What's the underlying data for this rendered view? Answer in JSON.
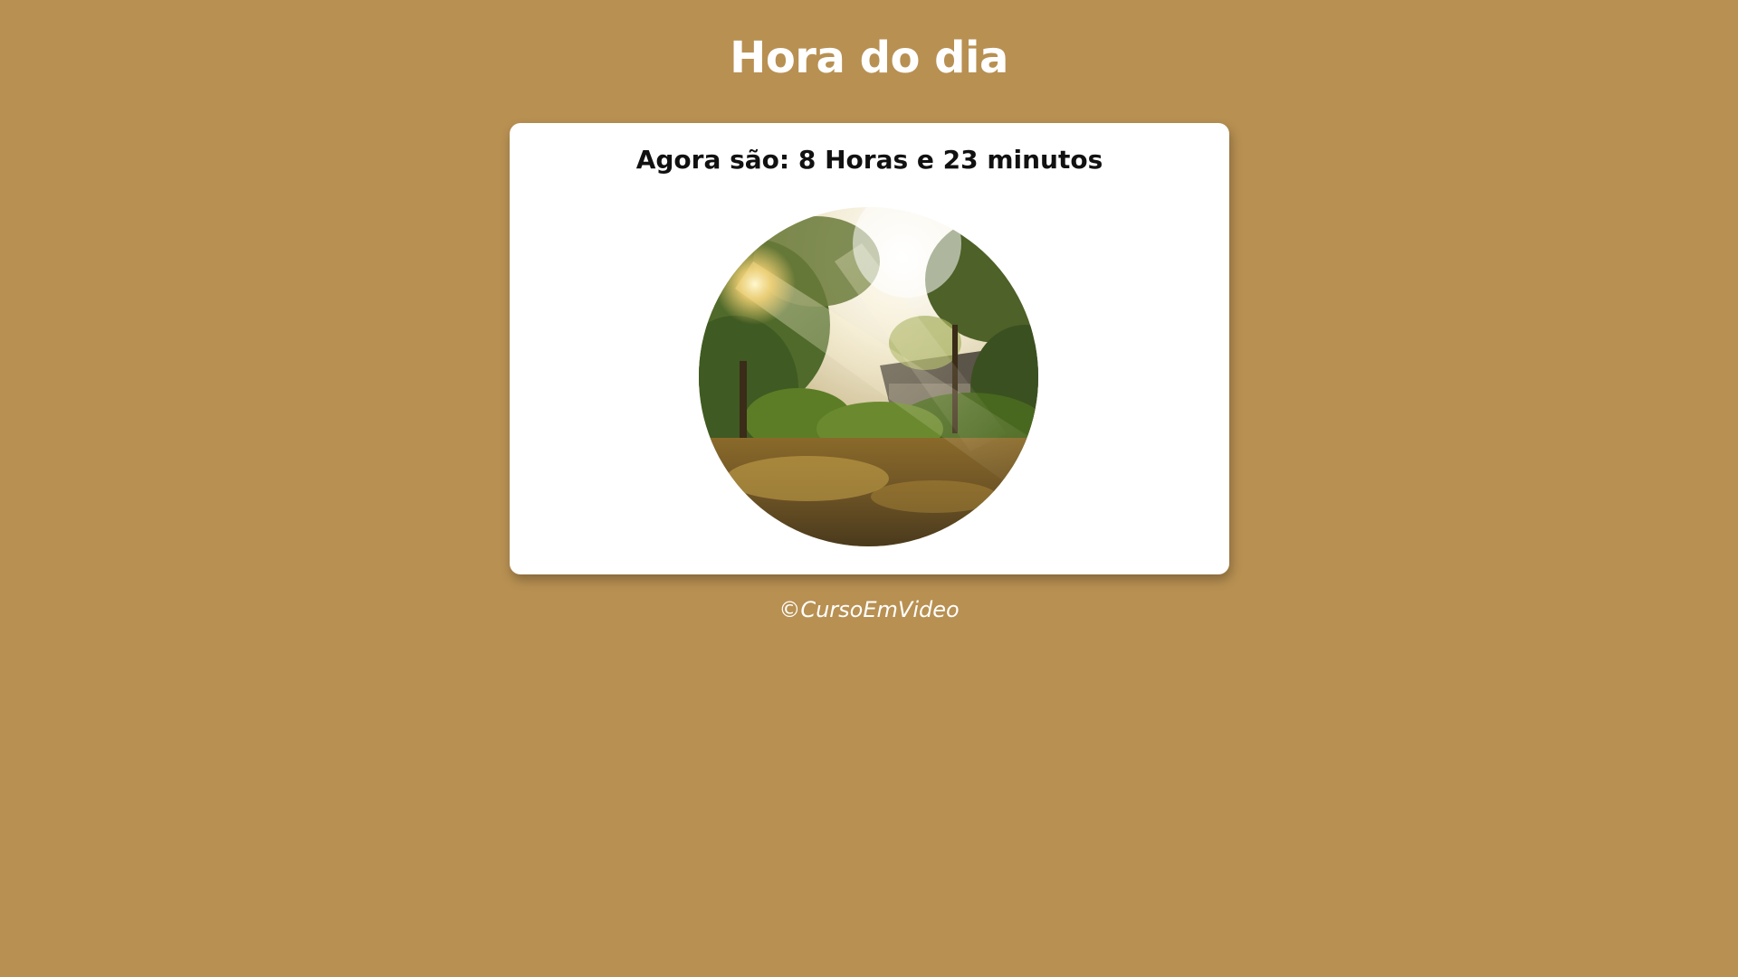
{
  "page": {
    "title": "Hora do dia",
    "background_color": "#b89052"
  },
  "card": {
    "time_message": "Agora são: 8 Horas e 23 minutos",
    "image": {
      "icon": "morning-garden-photo",
      "shape": "circle"
    }
  },
  "footer": {
    "text": "©CursoEmVideo"
  }
}
